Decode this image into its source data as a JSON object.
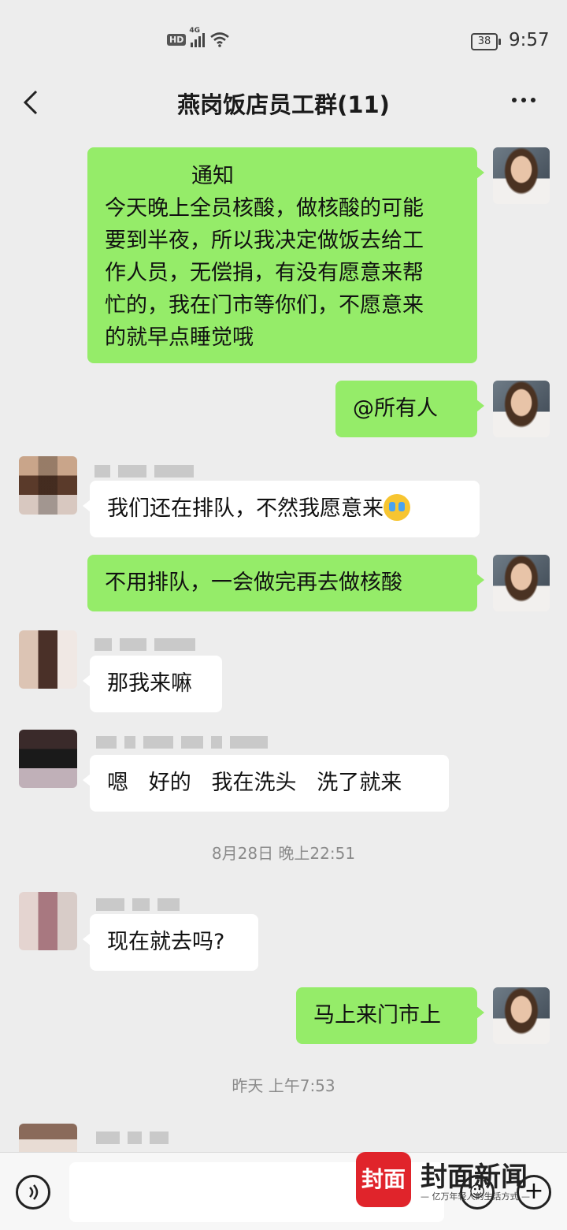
{
  "status_bar": {
    "hd": "HD",
    "network": "4G",
    "battery": "38",
    "time": "9:57"
  },
  "header": {
    "title": "燕岗饭店员工群(11)",
    "back_icon": "chevron-left-icon",
    "more_icon": "more-dots-icon"
  },
  "messages": {
    "m1": {
      "direction": "out",
      "title": "通知",
      "lines": [
        "今天晚上全员核酸，做核酸的可能",
        "要到半夜，所以我决定做饭去给工",
        "作人员，无偿捐，有没有愿意来帮",
        "忙的，我在门市等你们，不愿意来",
        "的就早点睡觉哦"
      ]
    },
    "m2": {
      "direction": "out",
      "text": "@所有人"
    },
    "m3": {
      "direction": "in",
      "text": "我们还在排队，不然我愿意来",
      "emoji": "crying-face-emoji"
    },
    "m4": {
      "direction": "out",
      "text": "不用排队，一会做完再去做核酸"
    },
    "m5": {
      "direction": "in",
      "text": "那我来嘛"
    },
    "m6": {
      "direction": "in",
      "text": "嗯   好的   我在洗头   洗了就来"
    },
    "ts1": "8月28日 晚上22:51",
    "m7": {
      "direction": "in",
      "text": "现在就去吗?"
    },
    "m8": {
      "direction": "out",
      "text": "马上来门市上"
    },
    "ts2": "昨天 上午7:53"
  },
  "input_bar": {
    "voice_icon": "voice-icon",
    "emoji_icon": "emoji-icon",
    "plus_icon": "plus-icon",
    "value": ""
  },
  "watermark": {
    "logo": "封面",
    "name": "封面新闻",
    "slogan": "— 亿万年轻人的生活方式 —"
  }
}
